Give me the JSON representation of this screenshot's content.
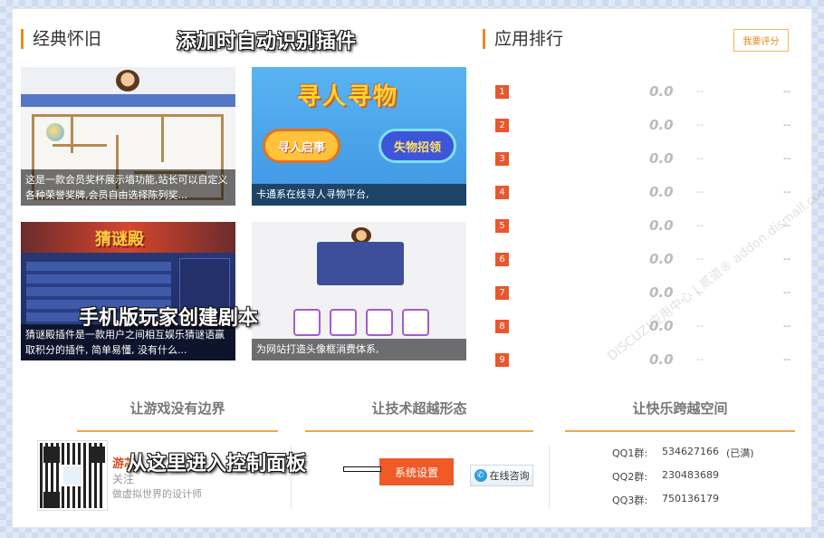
{
  "sections": {
    "classic": "经典怀旧",
    "ranking": "应用排行",
    "rate_button": "我要评分"
  },
  "annotations": {
    "auto_detect": "添加时自动识别插件",
    "mobile_script": "手机版玩家创建剧本",
    "enter_panel": "从这里进入控制面板"
  },
  "cards": [
    {
      "caption": "这是一款会员奖杯展示墙功能,站长可以自定义各种荣誉奖牌,会员自由选择陈列奖..."
    },
    {
      "caption": "卡通系在线寻人寻物平台,",
      "art_title": "寻人寻物",
      "btn_left": "寻人启事",
      "btn_right": "失物招领"
    },
    {
      "caption": "猜谜殿插件是一款用户之间相互娱乐猜谜语赢取积分的插件, 简单易懂, 没有什么...",
      "art_title": "猜谜殿"
    },
    {
      "caption": "为网站打造头像框消费体系,"
    }
  ],
  "ranking": [
    {
      "rank": "1",
      "score": "0.0",
      "c1": "--",
      "c2": "--"
    },
    {
      "rank": "2",
      "score": "0.0",
      "c1": "--",
      "c2": "--"
    },
    {
      "rank": "3",
      "score": "0.0",
      "c1": "--",
      "c2": "--"
    },
    {
      "rank": "4",
      "score": "0.0",
      "c1": "--",
      "c2": "--"
    },
    {
      "rank": "5",
      "score": "0.0",
      "c1": "--",
      "c2": "--"
    },
    {
      "rank": "6",
      "score": "0.0",
      "c1": "--",
      "c2": "--"
    },
    {
      "rank": "7",
      "score": "0.0",
      "c1": "--",
      "c2": "--"
    },
    {
      "rank": "8",
      "score": "0.0",
      "c1": "--",
      "c2": "--"
    },
    {
      "rank": "9",
      "score": "0.0",
      "c1": "--",
      "c2": "--"
    }
  ],
  "slogans": {
    "s1": "让游戏没有边界",
    "s2": "让技术超越形态",
    "s3": "让快乐跨越空间"
  },
  "footer": {
    "brand": "游芯",
    "follow": "关注",
    "designer": "做虚拟世界的设计师",
    "system_settings": "系统设置",
    "online_consult": "在线咨询"
  },
  "qq": [
    {
      "label": "QQ1群:",
      "number": "534627166",
      "note": "(已满)"
    },
    {
      "label": "QQ2群:",
      "number": "230483689",
      "note": ""
    },
    {
      "label": "QQ3群:",
      "number": "750136179",
      "note": ""
    }
  ],
  "watermark": "DISCUZ!应用中心 | 贰道®  addon.dismall.com"
}
